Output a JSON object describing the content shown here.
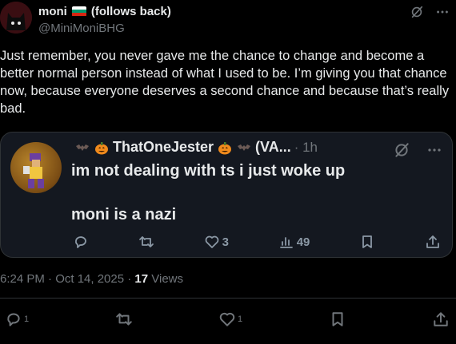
{
  "post": {
    "author_name": "moni",
    "follows_back": "(follows back)",
    "handle": "@MiniMoniBHG",
    "text": "Just remember, you never gave me the chance to change and become a better normal person instead of what I used to be. I’m giving you that chance now, because everyone deserves a second chance and because that’s really bad.",
    "timestamp": "6:24 PM · Oct 14, 2025 · ",
    "views_count": "17",
    "views_label": " Views",
    "reply_count": "1",
    "like_count": "1"
  },
  "quote": {
    "author_name": "ThatOneJester",
    "author_suffix": "(VA...",
    "time": "· 1h",
    "line1": "im not dealing with ts i just woke up",
    "line2": "moni is a nazi",
    "like_count": "3",
    "views_count": "49"
  },
  "icons": [
    "cat-avatar",
    "bulgaria-flag-icon",
    "grok-icon",
    "more-icon",
    "bat-emoji",
    "pumpkin-emoji",
    "reply-icon",
    "retweet-icon",
    "like-icon",
    "views-icon",
    "bookmark-icon",
    "share-icon"
  ],
  "colors": {
    "background": "#000000",
    "text": "#e7e9ea",
    "muted": "#71767b",
    "quote_bg": "#141820",
    "border": "#2f3336"
  }
}
